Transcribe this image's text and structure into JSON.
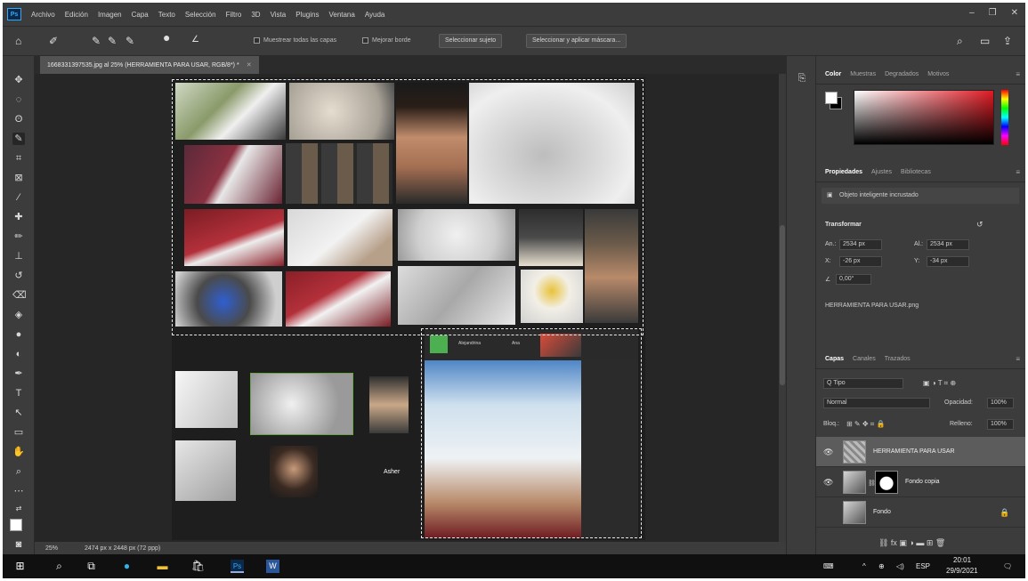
{
  "menu": [
    "Archivo",
    "Edición",
    "Imagen",
    "Capa",
    "Texto",
    "Selección",
    "Filtro",
    "3D",
    "Vista",
    "Plugins",
    "Ventana",
    "Ayuda"
  ],
  "app_logo": "Ps",
  "window_controls": {
    "minimize": "–",
    "restore": "❐",
    "close": "✕"
  },
  "options": {
    "sample_all_layers": "Muestrear todas las capas",
    "enhance_edge": "Mejorar borde",
    "select_subject": "Seleccionar sujeto",
    "select_and_mask": "Seleccionar y aplicar máscara..."
  },
  "document": {
    "tab_title": "1668331397535.jpg al 25% (HERRAMIENTA PARA USAR, RGB/8*) *",
    "zoom": "25%",
    "dimensions": "2474 px x 2448 px (72 ppp)",
    "zoom_meeting_labels": [
      "Alejandrina",
      "Ana",
      "Asher"
    ]
  },
  "panels": {
    "color_tabs": [
      "Color",
      "Muestras",
      "Degradados",
      "Motivos"
    ],
    "properties_tabs": [
      "Propiedades",
      "Ajustes",
      "Bibliotecas"
    ],
    "smart_object_label": "Objeto inteligente incrustado",
    "transform_title": "Transformar",
    "width": "2534 px",
    "height": "2534 px",
    "x": "-26 px",
    "y": "-34 px",
    "angle": "0,00°",
    "width_label": "An.:",
    "height_label": "Al.:",
    "x_label": "X:",
    "y_label": "Y:",
    "linked_file": "HERRAMIENTA PARA USAR.png",
    "layers_tabs": [
      "Capas",
      "Canales",
      "Trazados"
    ],
    "filter_kind": "Q Tipo",
    "blend_mode": "Normal",
    "opacity_label": "Opacidad:",
    "opacity": "100%",
    "lock_label": "Bloq.:",
    "fill_label": "Relleno:",
    "fill": "100%",
    "layers": [
      {
        "name": "HERRAMIENTA PARA USAR",
        "selected": true
      },
      {
        "name": "Fondo copia",
        "selected": false
      },
      {
        "name": "Fondo",
        "selected": false
      }
    ]
  },
  "taskbar": {
    "language": "ESP",
    "time": "20:01",
    "date": "29/9/2021"
  }
}
